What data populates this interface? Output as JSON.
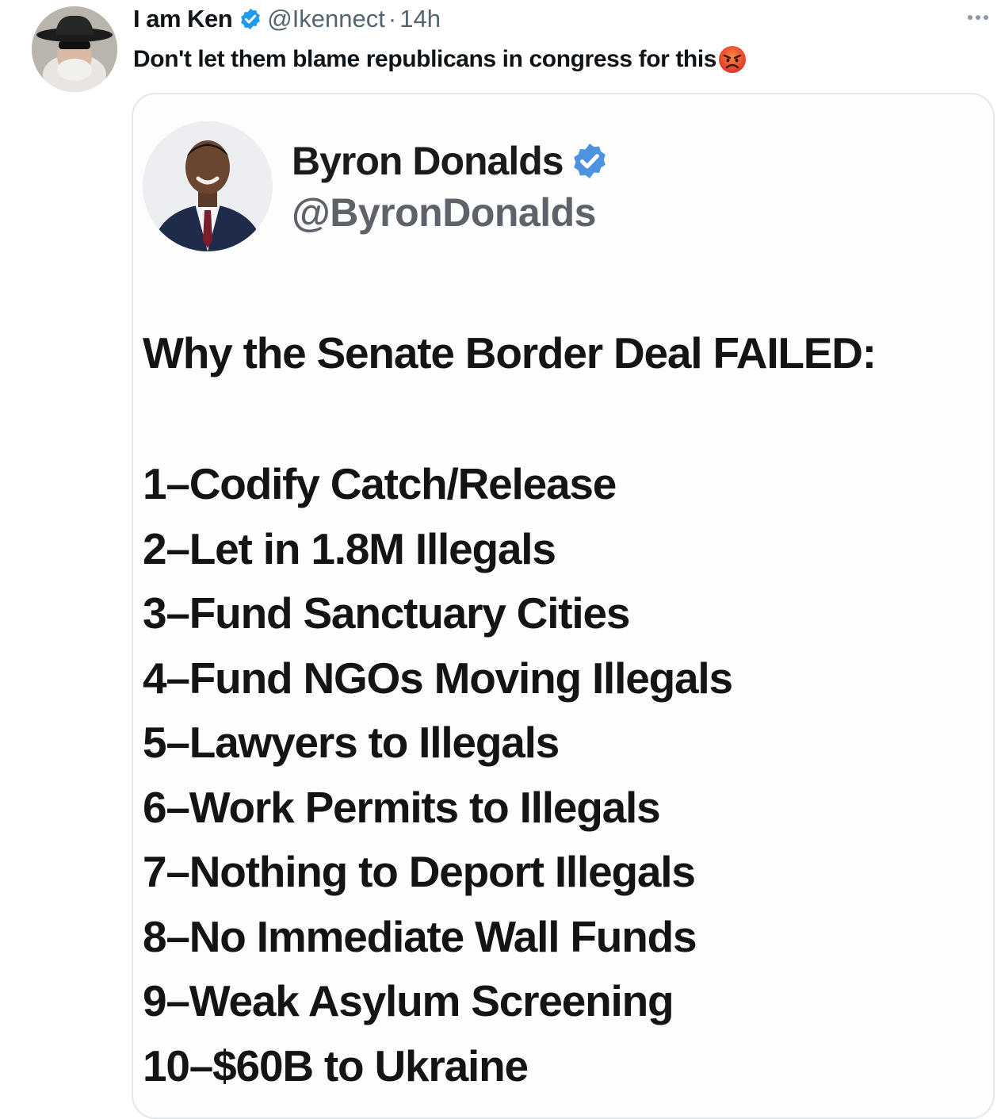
{
  "tweet": {
    "display_name": "I am Ken",
    "handle": "@Ikennect",
    "separator": "·",
    "time": "14h",
    "text": "Don't let them blame republicans in congress for this",
    "emoji": "angry-face-emoji",
    "more_icon": "more-horizontal-icon"
  },
  "embedded_image": {
    "author_name": "Byron Donalds",
    "author_handle": "@ByronDonalds",
    "headline": "Why the Senate Border Deal FAILED:",
    "reasons": [
      "1–Codify Catch/Release",
      "2–Let in 1.8M Illegals",
      "3–Fund Sanctuary Cities",
      "4–Fund NGOs Moving Illegals",
      "5–Lawyers to Illegals",
      "6–Work Permits to Illegals",
      "7–Nothing to Deport Illegals",
      "8–No Immediate Wall Funds",
      "9–Weak Asylum Screening",
      "10–$60B to Ukraine"
    ]
  },
  "colors": {
    "verified_blue": "#1d9bf0",
    "secondary_text": "#536471",
    "card_border": "#e4e8ec"
  }
}
